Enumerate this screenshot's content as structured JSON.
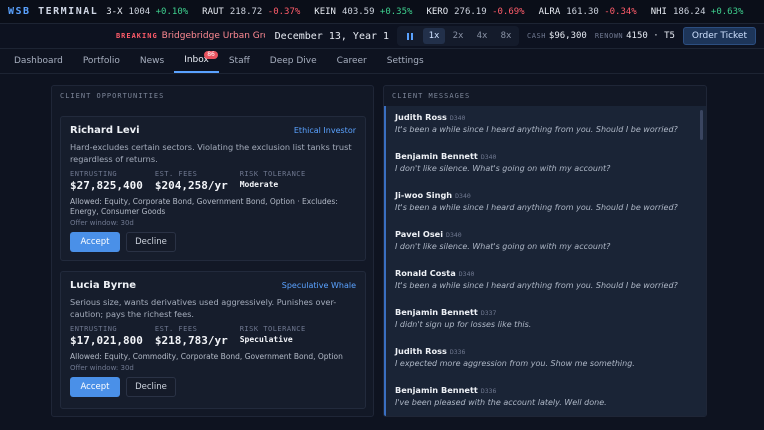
{
  "brand": {
    "prefix": "WSB",
    "name": "TERMINAL"
  },
  "tickers": [
    {
      "sym": "3-X",
      "price": "1004",
      "change": "+0.10%",
      "dir": "up"
    },
    {
      "sym": "RAUT",
      "price": "218.72",
      "change": "-0.37%",
      "dir": "down"
    },
    {
      "sym": "KEIN",
      "price": "403.59",
      "change": "+0.35%",
      "dir": "up"
    },
    {
      "sym": "KERO",
      "price": "276.19",
      "change": "-0.69%",
      "dir": "down"
    },
    {
      "sym": "ALRA",
      "price": "161.30",
      "change": "-0.34%",
      "dir": "down"
    },
    {
      "sym": "NHI",
      "price": "186.24",
      "change": "+0.63%",
      "dir": "up"
    }
  ],
  "status": {
    "breaking_label": "BREAKING",
    "breaking_text": "Bridgebridge Urban Group",
    "date": "December 13, Year 1",
    "speeds": [
      "1x",
      "2x",
      "4x",
      "8x"
    ],
    "cash_label": "CASH",
    "cash_value": "$96,300",
    "renown_label": "RENOWN",
    "renown_value": "4150 · T5",
    "order_button": "Order Ticket"
  },
  "nav": {
    "tabs": [
      "Dashboard",
      "Portfolio",
      "News",
      "Inbox",
      "Staff",
      "Deep Dive",
      "Career",
      "Settings"
    ],
    "inbox_badge": "86"
  },
  "opportunities": {
    "title": "CLIENT OPPORTUNITIES",
    "entrusting_label": "ENTRUSTING",
    "fees_label": "EST. FEES",
    "risk_label": "RISK TOLERANCE",
    "accept_label": "Accept",
    "decline_label": "Decline",
    "cards": [
      {
        "name": "Richard Levi",
        "type": "Ethical Investor",
        "desc": "Hard-excludes certain sectors. Violating the exclusion list tanks trust regardless of returns.",
        "entrusting": "$27,825,400",
        "fees": "$204,258/yr",
        "risk": "Moderate",
        "allowed": "Allowed: Equity, Corporate Bond, Government Bond, Option · Excludes: Energy, Consumer Goods",
        "window": "Offer window: 30d"
      },
      {
        "name": "Lucia Byrne",
        "type": "Speculative Whale",
        "desc": "Serious size, wants derivatives used aggressively. Punishes over-caution; pays the richest fees.",
        "entrusting": "$17,021,800",
        "fees": "$218,783/yr",
        "risk": "Speculative",
        "allowed": "Allowed: Equity, Commodity, Corporate Bond, Government Bond, Option",
        "window": "Offer window: 30d"
      }
    ]
  },
  "messages": {
    "title": "CLIENT MESSAGES",
    "items": [
      {
        "from": "Judith Ross",
        "num": "D340",
        "text": "It's been a while since I heard anything from you. Should I be worried?"
      },
      {
        "from": "Benjamin Bennett",
        "num": "D340",
        "text": "I don't like silence. What's going on with my account?"
      },
      {
        "from": "Ji-woo Singh",
        "num": "D340",
        "text": "It's been a while since I heard anything from you. Should I be worried?"
      },
      {
        "from": "Pavel Osei",
        "num": "D340",
        "text": "I don't like silence. What's going on with my account?"
      },
      {
        "from": "Ronald Costa",
        "num": "D340",
        "text": "It's been a while since I heard anything from you. Should I be worried?"
      },
      {
        "from": "Benjamin Bennett",
        "num": "D337",
        "text": "I didn't sign up for losses like this."
      },
      {
        "from": "Judith Ross",
        "num": "D336",
        "text": "I expected more aggression from you. Show me something."
      },
      {
        "from": "Benjamin Bennett",
        "num": "D336",
        "text": "I've been pleased with the account lately. Well done."
      }
    ]
  }
}
